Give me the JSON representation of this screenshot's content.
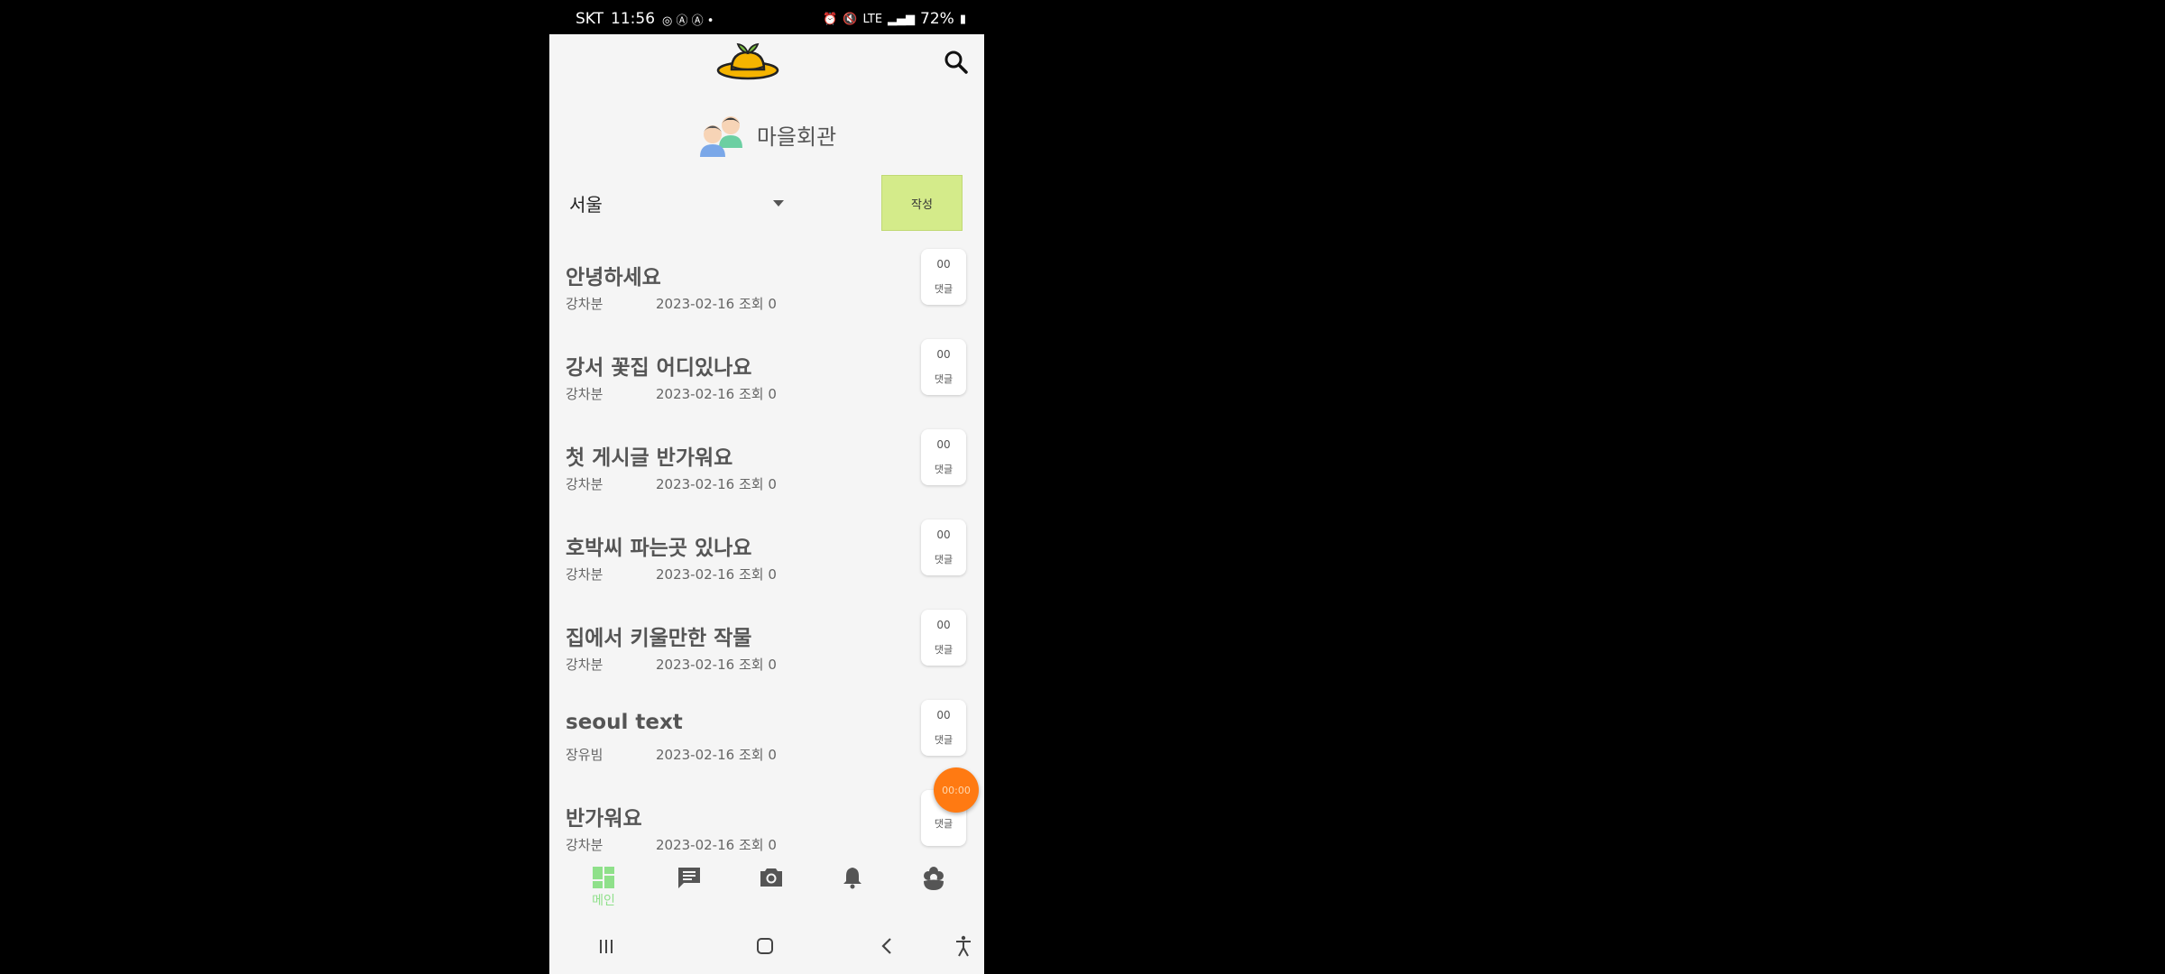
{
  "status_bar": {
    "carrier": "SKT",
    "time": "11:56",
    "network": "LTE",
    "battery": "72%"
  },
  "header": {
    "logo_icon": "straw-hat-sprout-logo",
    "search_icon": "search-icon"
  },
  "board": {
    "title": "마을회관",
    "icon": "people-icon"
  },
  "filter": {
    "selected_region": "서울",
    "write_label": "작성"
  },
  "posts": [
    {
      "title": "안녕하세요",
      "author": "강차분",
      "date": "2023-02-16",
      "views_label": "조회",
      "views": "0",
      "comment_count": "00",
      "comment_label": "댓글"
    },
    {
      "title": "강서 꽃집 어디있나요",
      "author": "강차분",
      "date": "2023-02-16",
      "views_label": "조회",
      "views": "0",
      "comment_count": "00",
      "comment_label": "댓글"
    },
    {
      "title": "첫 게시글 반가워요",
      "author": "강차분",
      "date": "2023-02-16",
      "views_label": "조회",
      "views": "0",
      "comment_count": "00",
      "comment_label": "댓글"
    },
    {
      "title": "호박씨 파는곳 있나요",
      "author": "강차분",
      "date": "2023-02-16",
      "views_label": "조회",
      "views": "0",
      "comment_count": "00",
      "comment_label": "댓글"
    },
    {
      "title": "집에서 키울만한 작물",
      "author": "강차분",
      "date": "2023-02-16",
      "views_label": "조회",
      "views": "0",
      "comment_count": "00",
      "comment_label": "댓글"
    },
    {
      "title": "seoul text",
      "author": "장유빔",
      "date": "2023-02-16",
      "views_label": "조회",
      "views": "0",
      "comment_count": "00",
      "comment_label": "댓글"
    },
    {
      "title": "반가워요",
      "author": "강차분",
      "date": "2023-02-16",
      "views_label": "조회",
      "views": "0",
      "comment_count": "",
      "comment_label": "댓글"
    }
  ],
  "record_fab": {
    "timer": "00:00"
  },
  "bottom_nav": {
    "items": [
      {
        "label": "메인",
        "icon": "dashboard-icon",
        "active": true
      },
      {
        "label": "",
        "icon": "chat-icon",
        "active": false
      },
      {
        "label": "",
        "icon": "camera-icon",
        "active": false
      },
      {
        "label": "",
        "icon": "bell-icon",
        "active": false
      },
      {
        "label": "",
        "icon": "flower-icon",
        "active": false
      }
    ]
  },
  "colors": {
    "accent_green": "#d4eb8a",
    "nav_active": "#8fe08a",
    "fab_orange": "#ff7a12"
  }
}
